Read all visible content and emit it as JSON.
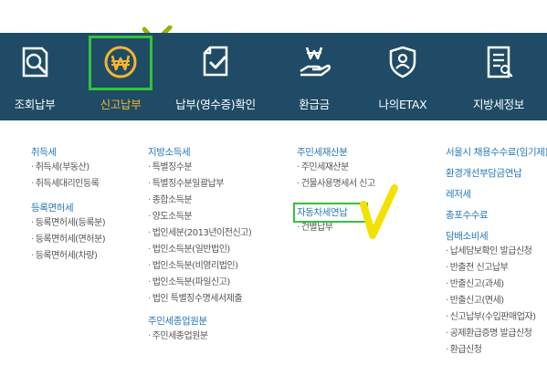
{
  "nav": {
    "items": [
      {
        "label": "조회납부",
        "icon": "search-document-icon"
      },
      {
        "label": "신고납부",
        "icon": "won-coin-icon"
      },
      {
        "label": "납부(영수증)확인",
        "icon": "checked-document-icon"
      },
      {
        "label": "환급금",
        "icon": "refund-hand-icon"
      },
      {
        "label": "나의ETAX",
        "icon": "user-shield-icon"
      },
      {
        "label": "지방세정보",
        "icon": "list-document-icon"
      }
    ],
    "active": "신고납부"
  },
  "menu": {
    "col1": [
      {
        "title": "취득세",
        "items": [
          "취득세(부동산)",
          "취득세대리인등록"
        ]
      },
      {
        "title": "등록면허세",
        "items": [
          "등록면허세(등록분)",
          "등록면허세(면허분)",
          "등록면허세(차량)"
        ]
      }
    ],
    "col2": [
      {
        "title": "지방소득세",
        "items": [
          "특별징수분",
          "특별징수분일괄납부",
          "종합소득분",
          "양도소득분",
          "법인세분(2013년이전신고)",
          "법인소득분(일반법인)",
          "법인소득분(비영리법인)",
          "법인소득분(파일신고)",
          "법인 특별징수명세서제출"
        ]
      },
      {
        "title": "주민세종업원분",
        "items": [
          "주민세종업원분"
        ]
      }
    ],
    "col3": [
      {
        "title": "주민세재산분",
        "items": [
          "주민세재산분",
          "건물사용명세서 신고"
        ]
      },
      {
        "title": "자동차세연납",
        "items": [
          "건별납부"
        ]
      }
    ],
    "col4": [
      {
        "title": "서울시 채용수수료(임기제)",
        "items": []
      },
      {
        "title": "환경개선부담금연납",
        "items": []
      },
      {
        "title": "레저세",
        "items": []
      },
      {
        "title": "총포수수료",
        "items": []
      },
      {
        "title": "담배소비세",
        "items": [
          "납세담보확인 발급신청",
          "반출전 신고납부",
          "반출신고(과세)",
          "반출신고(면세)",
          "신고납부(수입판매업자)",
          "공제환급증명 발급신청",
          "환급신청"
        ]
      }
    ]
  },
  "colors": {
    "nav_bg": "#1f4b66",
    "accent": "#f5b52e",
    "link": "#2a79b9",
    "highlight": "#34c23a",
    "annotation": "#f2e200"
  }
}
